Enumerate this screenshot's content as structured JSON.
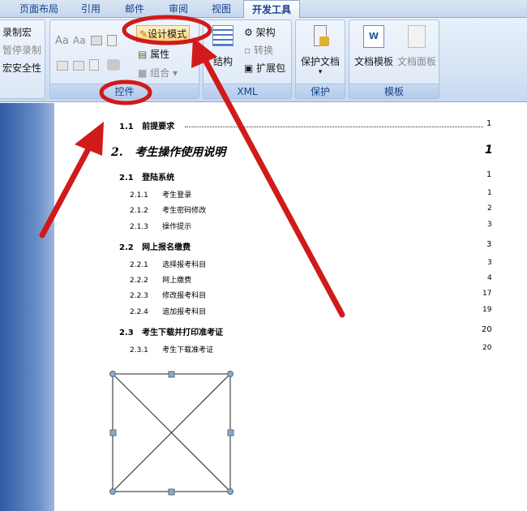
{
  "tabs": [
    "页面布局",
    "引用",
    "邮件",
    "审阅",
    "视图",
    "开发工具"
  ],
  "code_group": {
    "record": "录制宏",
    "pause": "暂停录制",
    "security": "宏安全性"
  },
  "controls_group": {
    "label": "控件",
    "design_mode": "设计模式",
    "properties": "属性",
    "group": "组合",
    "aa1": "Aa",
    "aa2": "Aa"
  },
  "xml_group": {
    "label": "XML",
    "structure": "结构",
    "schema": "架构",
    "transform": "转换",
    "expansion": "扩展包"
  },
  "protect_group": {
    "label": "保护",
    "protect_doc": "保护文档"
  },
  "templates_group": {
    "label": "模板",
    "doc_template": "文档模板",
    "doc_panel": "文档面板"
  },
  "toc": [
    {
      "num": "1.1",
      "title": "前提要求",
      "page": "1"
    },
    {
      "num": "2.",
      "title": "考生操作使用说明",
      "page": "1"
    },
    {
      "num": "2.1",
      "title": "登陆系统",
      "page": "1"
    },
    {
      "num": "2.1.1",
      "title": "考生登录",
      "page": "1"
    },
    {
      "num": "2.1.2",
      "title": "考生密码修改",
      "page": "2"
    },
    {
      "num": "2.1.3",
      "title": "操作提示",
      "page": "3"
    },
    {
      "num": "2.2",
      "title": "网上报名缴费",
      "page": "3"
    },
    {
      "num": "2.2.1",
      "title": "选择报考科目",
      "page": "3"
    },
    {
      "num": "2.2.2",
      "title": "网上缴费",
      "page": "4"
    },
    {
      "num": "2.2.3",
      "title": "修改报考科目",
      "page": "17"
    },
    {
      "num": "2.2.4",
      "title": "追加报考科目",
      "page": "19"
    },
    {
      "num": "2.3",
      "title": "考生下载并打印准考证",
      "page": "20"
    },
    {
      "num": "2.3.1",
      "title": "考生下载准考证",
      "page": "20"
    }
  ]
}
